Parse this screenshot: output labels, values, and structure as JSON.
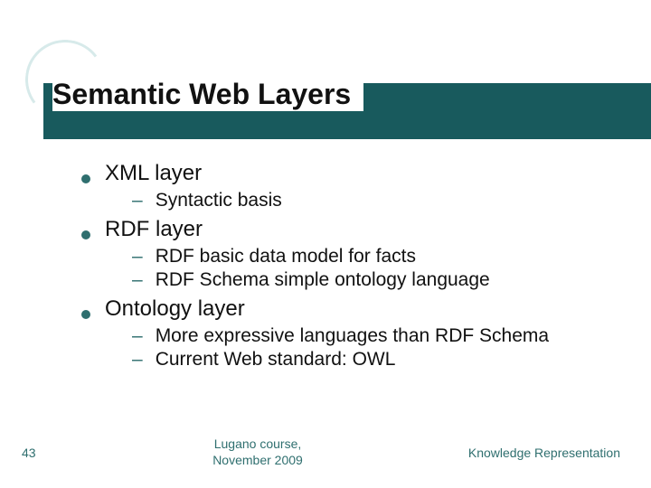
{
  "title": "Semantic Web Layers",
  "bullets": [
    {
      "label": "XML layer",
      "sub": [
        "Syntactic basis"
      ]
    },
    {
      "label": "RDF layer",
      "sub": [
        "RDF basic data model for facts",
        "RDF Schema simple ontology language"
      ]
    },
    {
      "label": "Ontology layer",
      "sub": [
        "More expressive languages than RDF Schema",
        "Current Web standard: OWL"
      ]
    }
  ],
  "footer": {
    "page": "43",
    "center_line1": "Lugano course,",
    "center_line2": "November 2009",
    "right": "Knowledge Representation"
  },
  "colors": {
    "accent": "#185a5d",
    "bullet": "#2f6f6f"
  }
}
